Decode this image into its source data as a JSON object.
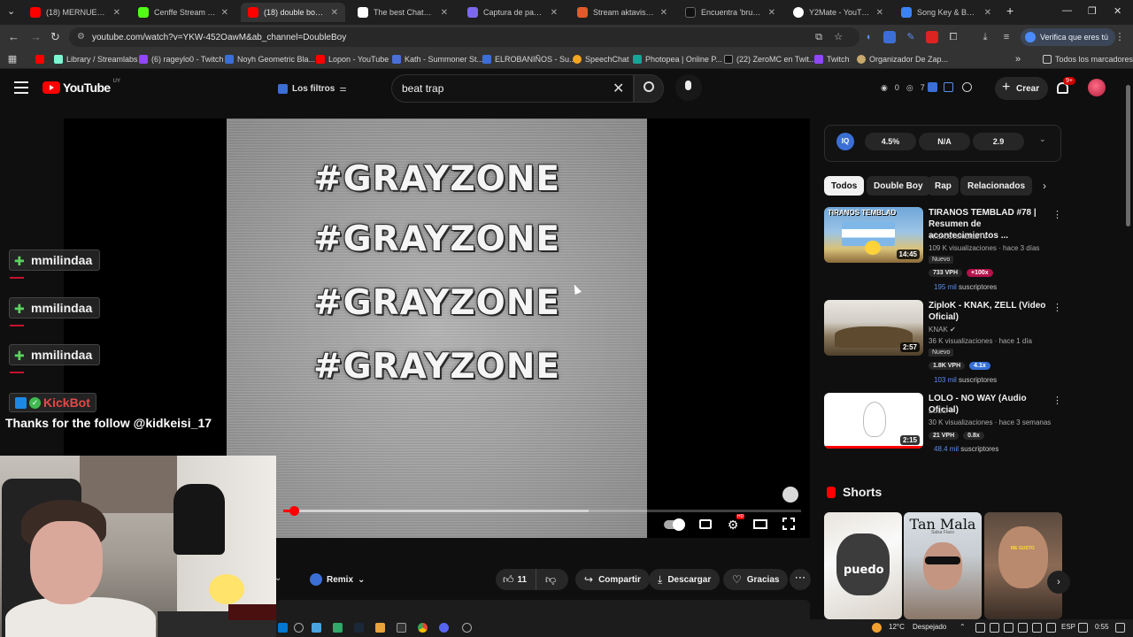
{
  "browser": {
    "tabs": [
      {
        "title": "(18) MERNUEL Y MC",
        "color": "#ff0000"
      },
      {
        "title": "Cenffe Stream - Watc",
        "color": "#53fc18"
      },
      {
        "title": "(18) double boy - BO",
        "color": "#ff0000"
      },
      {
        "title": "The best ChatBot and",
        "color": "#ffffff"
      },
      {
        "title": "Captura de pantalla p",
        "color": "#7b68ee"
      },
      {
        "title": "Stream aktavisss mu",
        "color": "#e05a2b"
      },
      {
        "title": "Encuentra 'brunenge",
        "color": "#111111"
      },
      {
        "title": "Y2Mate - YouTube to",
        "color": "#ffffff"
      },
      {
        "title": "Song Key & BPM Fin",
        "color": "#3b82f6"
      }
    ],
    "active_tab_index": 2,
    "url": "youtube.com/watch?v=YKW-452OawM&ab_channel=DoubleBoy",
    "verify_label": "Verifica que eres tú",
    "bookmarks": [
      {
        "label": "",
        "color": "#ff0000"
      },
      {
        "label": "Library / Streamlabs",
        "color": "#80f5d2"
      },
      {
        "label": "(6) rageylo0 - Twitch",
        "color": "#9146ff"
      },
      {
        "label": "Noyh Geometric Bla...",
        "color": "#3b6fd6"
      },
      {
        "label": "Lopon - YouTube",
        "color": "#ff0000"
      },
      {
        "label": "Kath - Summoner St...",
        "color": "#4a6fd6"
      },
      {
        "label": "ELROBANIÑOS - Su...",
        "color": "#3b6fd6"
      },
      {
        "label": "SpeechChat",
        "color": "#f5a623"
      },
      {
        "label": "Photopea | Online P...",
        "color": "#18a497"
      },
      {
        "label": "(22) ZeroMC en Twit...",
        "color": "#111111"
      },
      {
        "label": "Twitch",
        "color": "#9146ff"
      },
      {
        "label": "Organizador De Zap...",
        "color": "#c9a86b"
      }
    ],
    "all_bookmarks_label": "Todos los marcadores"
  },
  "yt": {
    "logo_text": "YouTube",
    "country_code": "UY",
    "filters_label": "Los filtros",
    "search_value": "beat trap",
    "header_stats": {
      "a": "0",
      "b": "7"
    },
    "create_label": "Crear",
    "notif_count": "9+"
  },
  "video": {
    "overlay_lines": [
      "#GRAYZONE",
      "#GRAYZONE",
      "#GRAYZONE",
      "#GRAYZONE"
    ],
    "progress_played": 0.02,
    "progress_buffered": 0.59
  },
  "overlay": {
    "chat_names": [
      "mmilindaa",
      "mmilindaa",
      "mmilindaa"
    ],
    "bot_name": "KickBot",
    "bot_message": "Thanks for the follow @kidkeisi_17"
  },
  "actions": {
    "remix_label": "Remix",
    "like_count": "11",
    "share_label": "Compartir",
    "download_label": "Descargar",
    "thanks_label": "Gracias"
  },
  "sidebar": {
    "iq_logo": "IQ",
    "iq_stats": [
      "4.5%",
      "N/A",
      "2.9"
    ],
    "chips": [
      "Todos",
      "Double Boy",
      "Rap",
      "Relacionados"
    ],
    "active_chip_index": 0,
    "recommendations": [
      {
        "title": "TIRANOS TEMBLAD #78 | Resumen de acontecimientos ...",
        "channel": "TiranosTembladTV",
        "meta": "109 K visualizaciones · hace 3 días",
        "duration": "14:45",
        "badge": "Nuevo",
        "vph": "733 VPH",
        "multiplier": "+100x",
        "subs_num": "195 mil",
        "subs_label": "suscriptores",
        "thumb_text": "TIRANOS TEMBLAD"
      },
      {
        "title": "ZiploK - KNAK, ZELL (Video Oficial)",
        "channel": "KNAK",
        "meta": "36 K visualizaciones · hace 1 día",
        "duration": "2:57",
        "badge": "Nuevo",
        "vph": "1.8K VPH",
        "multiplier": "4.1x",
        "subs_num": "103 mil",
        "subs_label": "suscriptores"
      },
      {
        "title": "LOLO - NO WAY (Audio Oficial)",
        "channel": "LOLO",
        "meta": "30 K visualizaciones · hace 3 semanas",
        "duration": "2:15",
        "vph": "21 VPH",
        "multiplier": "0.8x",
        "subs_num": "48.4 mil",
        "subs_label": "suscriptores"
      }
    ],
    "shorts_label": "Shorts",
    "shorts": [
      {
        "title": "puedo",
        "subtitle": ""
      },
      {
        "title": "Tan Mala",
        "subtitle": "Salsa Flaco"
      },
      {
        "title": "",
        "subtitle": "ME GUSTO"
      }
    ]
  },
  "taskbar": {
    "temperature": "12°C",
    "weather": "Despejado",
    "lang": "ESP",
    "time": "0:55"
  }
}
